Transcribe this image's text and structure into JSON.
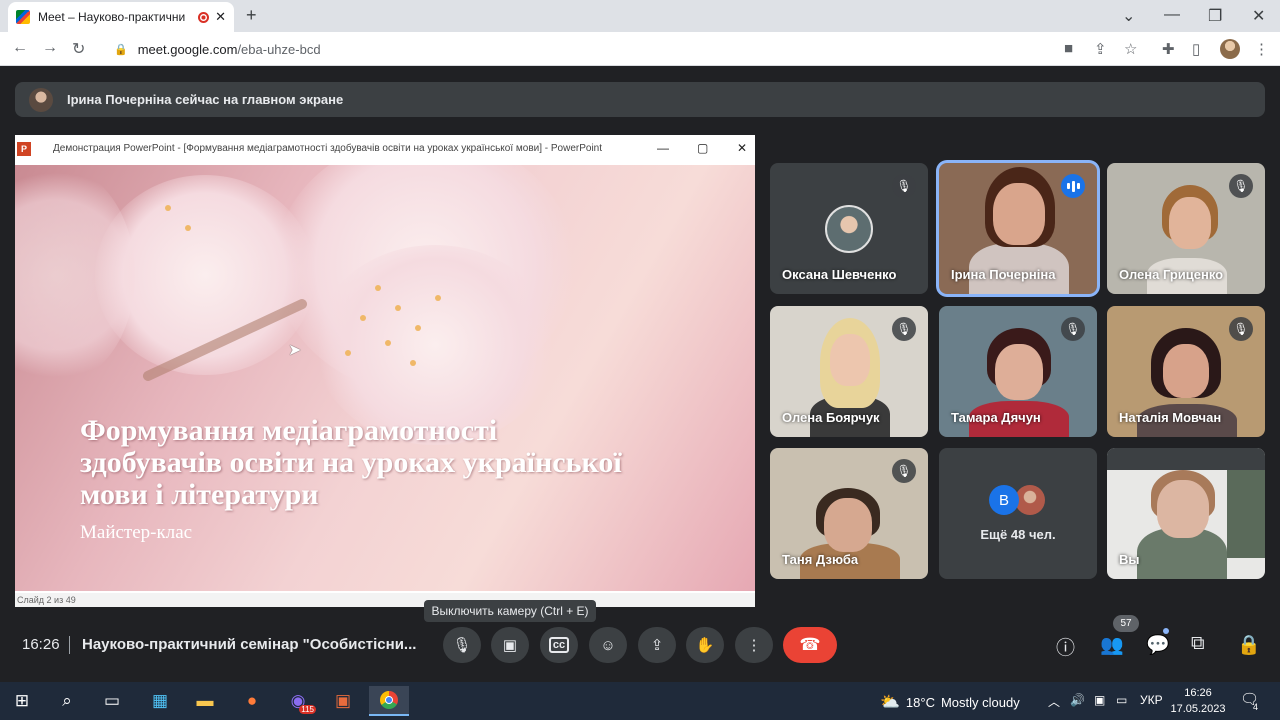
{
  "browser": {
    "tab_title": "Meet – Науково-практични",
    "tab_close": "✕",
    "new_tab": "+",
    "url_host": "meet.google.com",
    "url_path": "/eba-uhze-bcd"
  },
  "banner": {
    "text": "Ірина Почерніна сейчас на главном экране"
  },
  "presentation": {
    "window_title": "Демонстрация PowerPoint - [Формування медіаграмотності здобувачів освіти на уроках української мови] - PowerPoint",
    "slide_title": "Формування медіаграмотності здобувачів освіти на уроках української мови і літератури",
    "slide_subtitle": "Майстер-клас",
    "status_text": "Слайд 2 из 49"
  },
  "participants": [
    {
      "name": "Оксана Шевченко",
      "muted": true
    },
    {
      "name": "Ірина Почерніна",
      "muted": false,
      "speaking": true
    },
    {
      "name": "Олена Гриценко",
      "muted": true
    },
    {
      "name": "Олена Боярчук",
      "muted": true
    },
    {
      "name": "Тамара Дячун",
      "muted": true
    },
    {
      "name": "Наталія Мовчан",
      "muted": true
    },
    {
      "name": "Таня Дзюба",
      "muted": true
    },
    {
      "name": "Ещё 48 чел.",
      "avatar_letter": "В"
    },
    {
      "name": "Вы"
    }
  ],
  "tooltip": "Выключить камеру (Ctrl + E)",
  "meeting": {
    "time": "16:26",
    "name": "Науково-практичний семінар \"Особистісни..."
  },
  "controls": {
    "people_count": "57"
  },
  "taskbar": {
    "temperature": "18°C",
    "weather": "Mostly cloudy",
    "lang": "УКР",
    "clock_time": "16:26",
    "clock_date": "17.05.2023",
    "notification_count": "4",
    "viber_badge": "115"
  },
  "colors": {
    "meet_bg": "#202124",
    "tile_bg": "#3c4043",
    "hangup": "#ea4335",
    "speaking_border": "#8ab4f8"
  }
}
